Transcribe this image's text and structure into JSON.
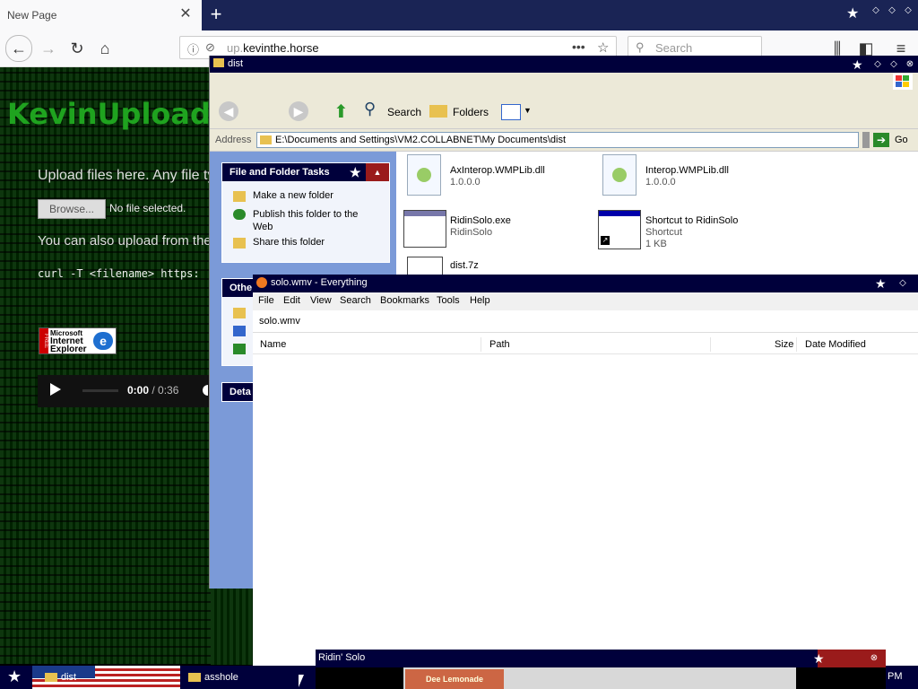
{
  "browser": {
    "tab_title": "New Page",
    "url_prefix": "up.",
    "url_domain": "kevinthe.horse",
    "search_placeholder": "Search"
  },
  "webpage": {
    "logo": "KevinUploads",
    "upload_text": "Upload files here. Any file ty",
    "browse_label": "Browse...",
    "no_file": "No file selected.",
    "also_text": "You can also upload from the",
    "curl_text": "curl -T <filename> https:",
    "ie_badge": {
      "line1": "Microsoft",
      "line2": "Internet",
      "line3": "Explorer",
      "free": "FREE"
    },
    "player": {
      "current": "0:00",
      "total": " / 0:36"
    }
  },
  "explorer": {
    "title": "dist",
    "toolbar": {
      "back": "Back",
      "search": "Search",
      "folders": "Folders"
    },
    "address_label": "Address",
    "address_value": "E:\\Documents and Settings\\VM2.COLLABNET\\My Documents\\dist",
    "go_label": "Go",
    "tasks_title": "File and Folder Tasks",
    "tasks": [
      "Make a new folder",
      "Publish this folder to the Web",
      "Share this folder"
    ],
    "other_title": "Othe",
    "details_title": "Deta",
    "files": [
      {
        "name": "AxInterop.WMPLib.dll",
        "sub": "1.0.0.0"
      },
      {
        "name": "Interop.WMPLib.dll",
        "sub": "1.0.0.0"
      },
      {
        "name": "RidinSolo.exe",
        "sub": "RidinSolo"
      },
      {
        "name": "Shortcut to RidinSolo",
        "sub": "Shortcut",
        "sub2": "1 KB"
      },
      {
        "name": "dist.7z",
        "sub": ""
      }
    ]
  },
  "everything": {
    "title": "solo.wmv - Everything",
    "menu": [
      "File",
      "Edit",
      "View",
      "Search",
      "Bookmarks",
      "Tools",
      "Help"
    ],
    "search_value": "solo.wmv",
    "columns": [
      "Name",
      "Path",
      "Size",
      "Date Modified"
    ]
  },
  "media": {
    "title": "Ridin' Solo",
    "thumb_text": "Dee Lemonade"
  },
  "taskbar": {
    "tasks": [
      "dist",
      "asshole"
    ],
    "clock": "PM"
  }
}
